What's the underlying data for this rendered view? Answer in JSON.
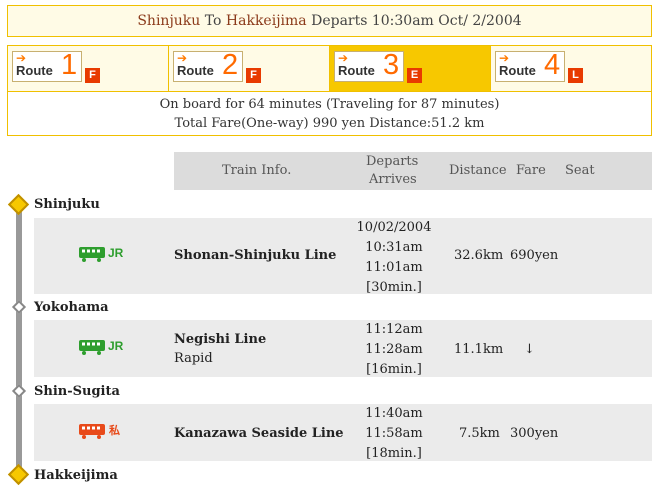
{
  "header": {
    "from": "Shinjuku",
    "to_word": "To",
    "to": "Hakkeijima",
    "departs_text": "Departs 10:30am Oct/ 2/2004"
  },
  "routes": [
    {
      "label": "Route",
      "num": "1",
      "badge": "F",
      "active": false
    },
    {
      "label": "Route",
      "num": "2",
      "badge": "F",
      "active": false
    },
    {
      "label": "Route",
      "num": "3",
      "badge": "E",
      "active": true
    },
    {
      "label": "Route",
      "num": "4",
      "badge": "L",
      "active": false
    }
  ],
  "summary": {
    "line1": "On board for 64 minutes (Traveling for 87 minutes)",
    "line2": "Total Fare(One-way) 990 yen Distance:51.2 km"
  },
  "table_header": {
    "train_info": "Train Info.",
    "departs": "Departs",
    "arrives": "Arrives",
    "distance": "Distance",
    "fare": "Fare",
    "seat": "Seat"
  },
  "stations": [
    "Shinjuku",
    "Yokohama",
    "Shin-Sugita",
    "Hakkeijima"
  ],
  "segments": [
    {
      "operator": "JR",
      "operator_color": "#2e9e2e",
      "line": "Shonan-Shinjuku Line",
      "service": "",
      "date": "10/02/2004",
      "depart": "10:31am",
      "arrive": "11:01am",
      "duration": "[30min.]",
      "distance": "32.6km",
      "fare": "690yen"
    },
    {
      "operator": "JR",
      "operator_color": "#2e9e2e",
      "line": "Negishi Line",
      "service": "Rapid",
      "date": "",
      "depart": "11:12am",
      "arrive": "11:28am",
      "duration": "[16min.]",
      "distance": "11.1km",
      "fare": "↓"
    },
    {
      "operator": "私",
      "operator_color": "#e84a1a",
      "line": "Kanazawa Seaside Line",
      "service": "",
      "date": "",
      "depart": "11:40am",
      "arrive": "11:58am",
      "duration": "[18min.]",
      "distance": "7.5km",
      "fare": "300yen"
    }
  ]
}
